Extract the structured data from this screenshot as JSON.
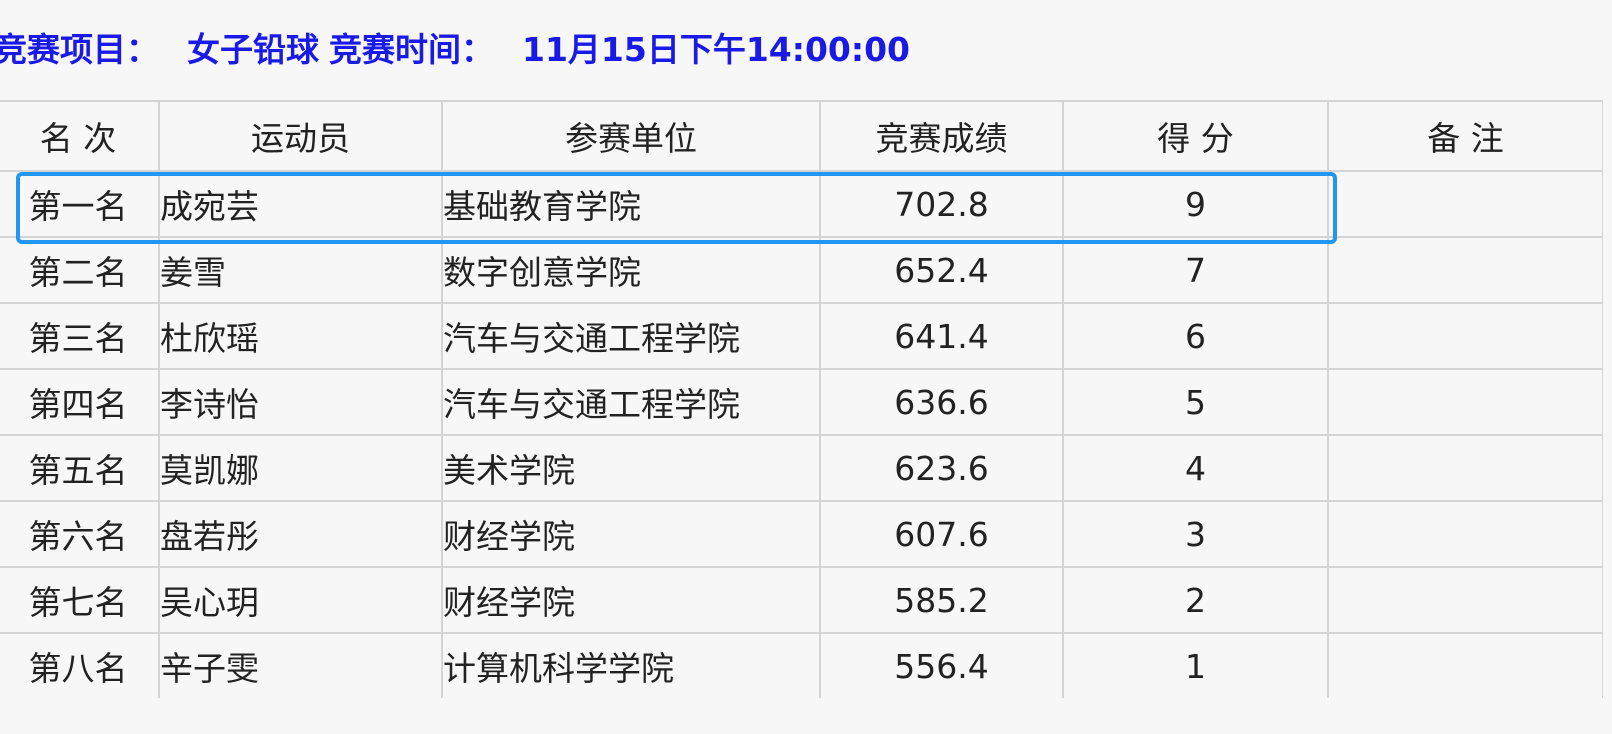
{
  "header": {
    "event_label": "竞赛项目：",
    "event_value": "女子铅球",
    "time_label": "竞赛时间：",
    "time_value": "11月15日下午14:00:00"
  },
  "table": {
    "columns": [
      "名 次",
      "运动员",
      "参赛单位",
      "竞赛成绩",
      "得 分",
      "备 注"
    ],
    "rows": [
      {
        "rank": "第一名",
        "athlete": "成宛芸",
        "unit": "基础教育学院",
        "result": "702.8",
        "points": "9",
        "note": ""
      },
      {
        "rank": "第二名",
        "athlete": "姜雪",
        "unit": "数字创意学院",
        "result": "652.4",
        "points": "7",
        "note": ""
      },
      {
        "rank": "第三名",
        "athlete": "杜欣瑶",
        "unit": "汽车与交通工程学院",
        "result": "641.4",
        "points": "6",
        "note": ""
      },
      {
        "rank": "第四名",
        "athlete": "李诗怡",
        "unit": "汽车与交通工程学院",
        "result": "636.6",
        "points": "5",
        "note": ""
      },
      {
        "rank": "第五名",
        "athlete": "莫凯娜",
        "unit": "美术学院",
        "result": "623.6",
        "points": "4",
        "note": ""
      },
      {
        "rank": "第六名",
        "athlete": "盘若彤",
        "unit": "财经学院",
        "result": "607.6",
        "points": "3",
        "note": ""
      },
      {
        "rank": "第七名",
        "athlete": "吴心玥",
        "unit": "财经学院",
        "result": "585.2",
        "points": "2",
        "note": ""
      },
      {
        "rank": "第八名",
        "athlete": "辛子雯",
        "unit": "计算机科学学院",
        "result": "556.4",
        "points": "1",
        "note": ""
      }
    ]
  },
  "highlight": {
    "row": "第一名",
    "color": "#2196f3"
  },
  "colors": {
    "header_text": "#1a1ae6",
    "grid": "#d4d4d4",
    "background": "#f7f7f7"
  }
}
